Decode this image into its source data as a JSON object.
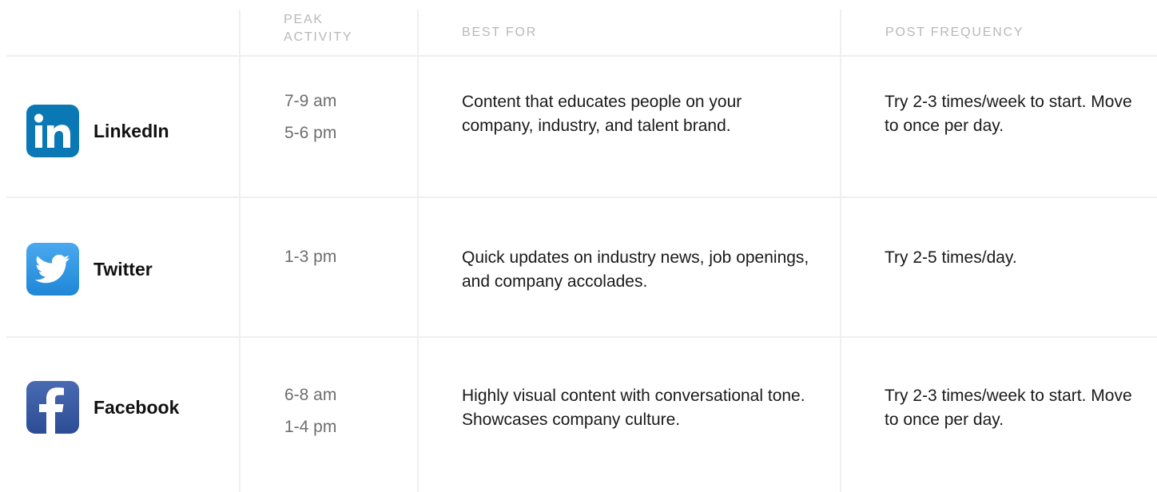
{
  "headers": {
    "peak_activity_line1": "PEAK",
    "peak_activity_line2": "ACTIVITY",
    "best_for": "BEST FOR",
    "post_frequency": "POST FREQUENCY"
  },
  "rows": [
    {
      "platform": "LinkedIn",
      "icon": "linkedin-icon",
      "brand_color": "#0a78b5",
      "peak_times": [
        "7-9 am",
        "5-6 pm"
      ],
      "best_for": "Content that educates people on your company, industry, and talent brand.",
      "post_frequency": "Try 2-3 times/week to start. Move to once per day."
    },
    {
      "platform": "Twitter",
      "icon": "twitter-bird-icon",
      "brand_color": "#2a93e0",
      "peak_times": [
        "1-3 pm"
      ],
      "best_for": "Quick updates on industry news, job openings, and company accolades.",
      "post_frequency": "Try 2-5 times/day."
    },
    {
      "platform": "Facebook",
      "icon": "facebook-icon",
      "brand_color": "#3b5ba5",
      "peak_times": [
        "6-8 am",
        "1-4 pm"
      ],
      "best_for": "Highly visual content with conversational tone. Showcases company culture.",
      "post_frequency": "Try 2-3 times/week to start. Move to once per day."
    }
  ]
}
